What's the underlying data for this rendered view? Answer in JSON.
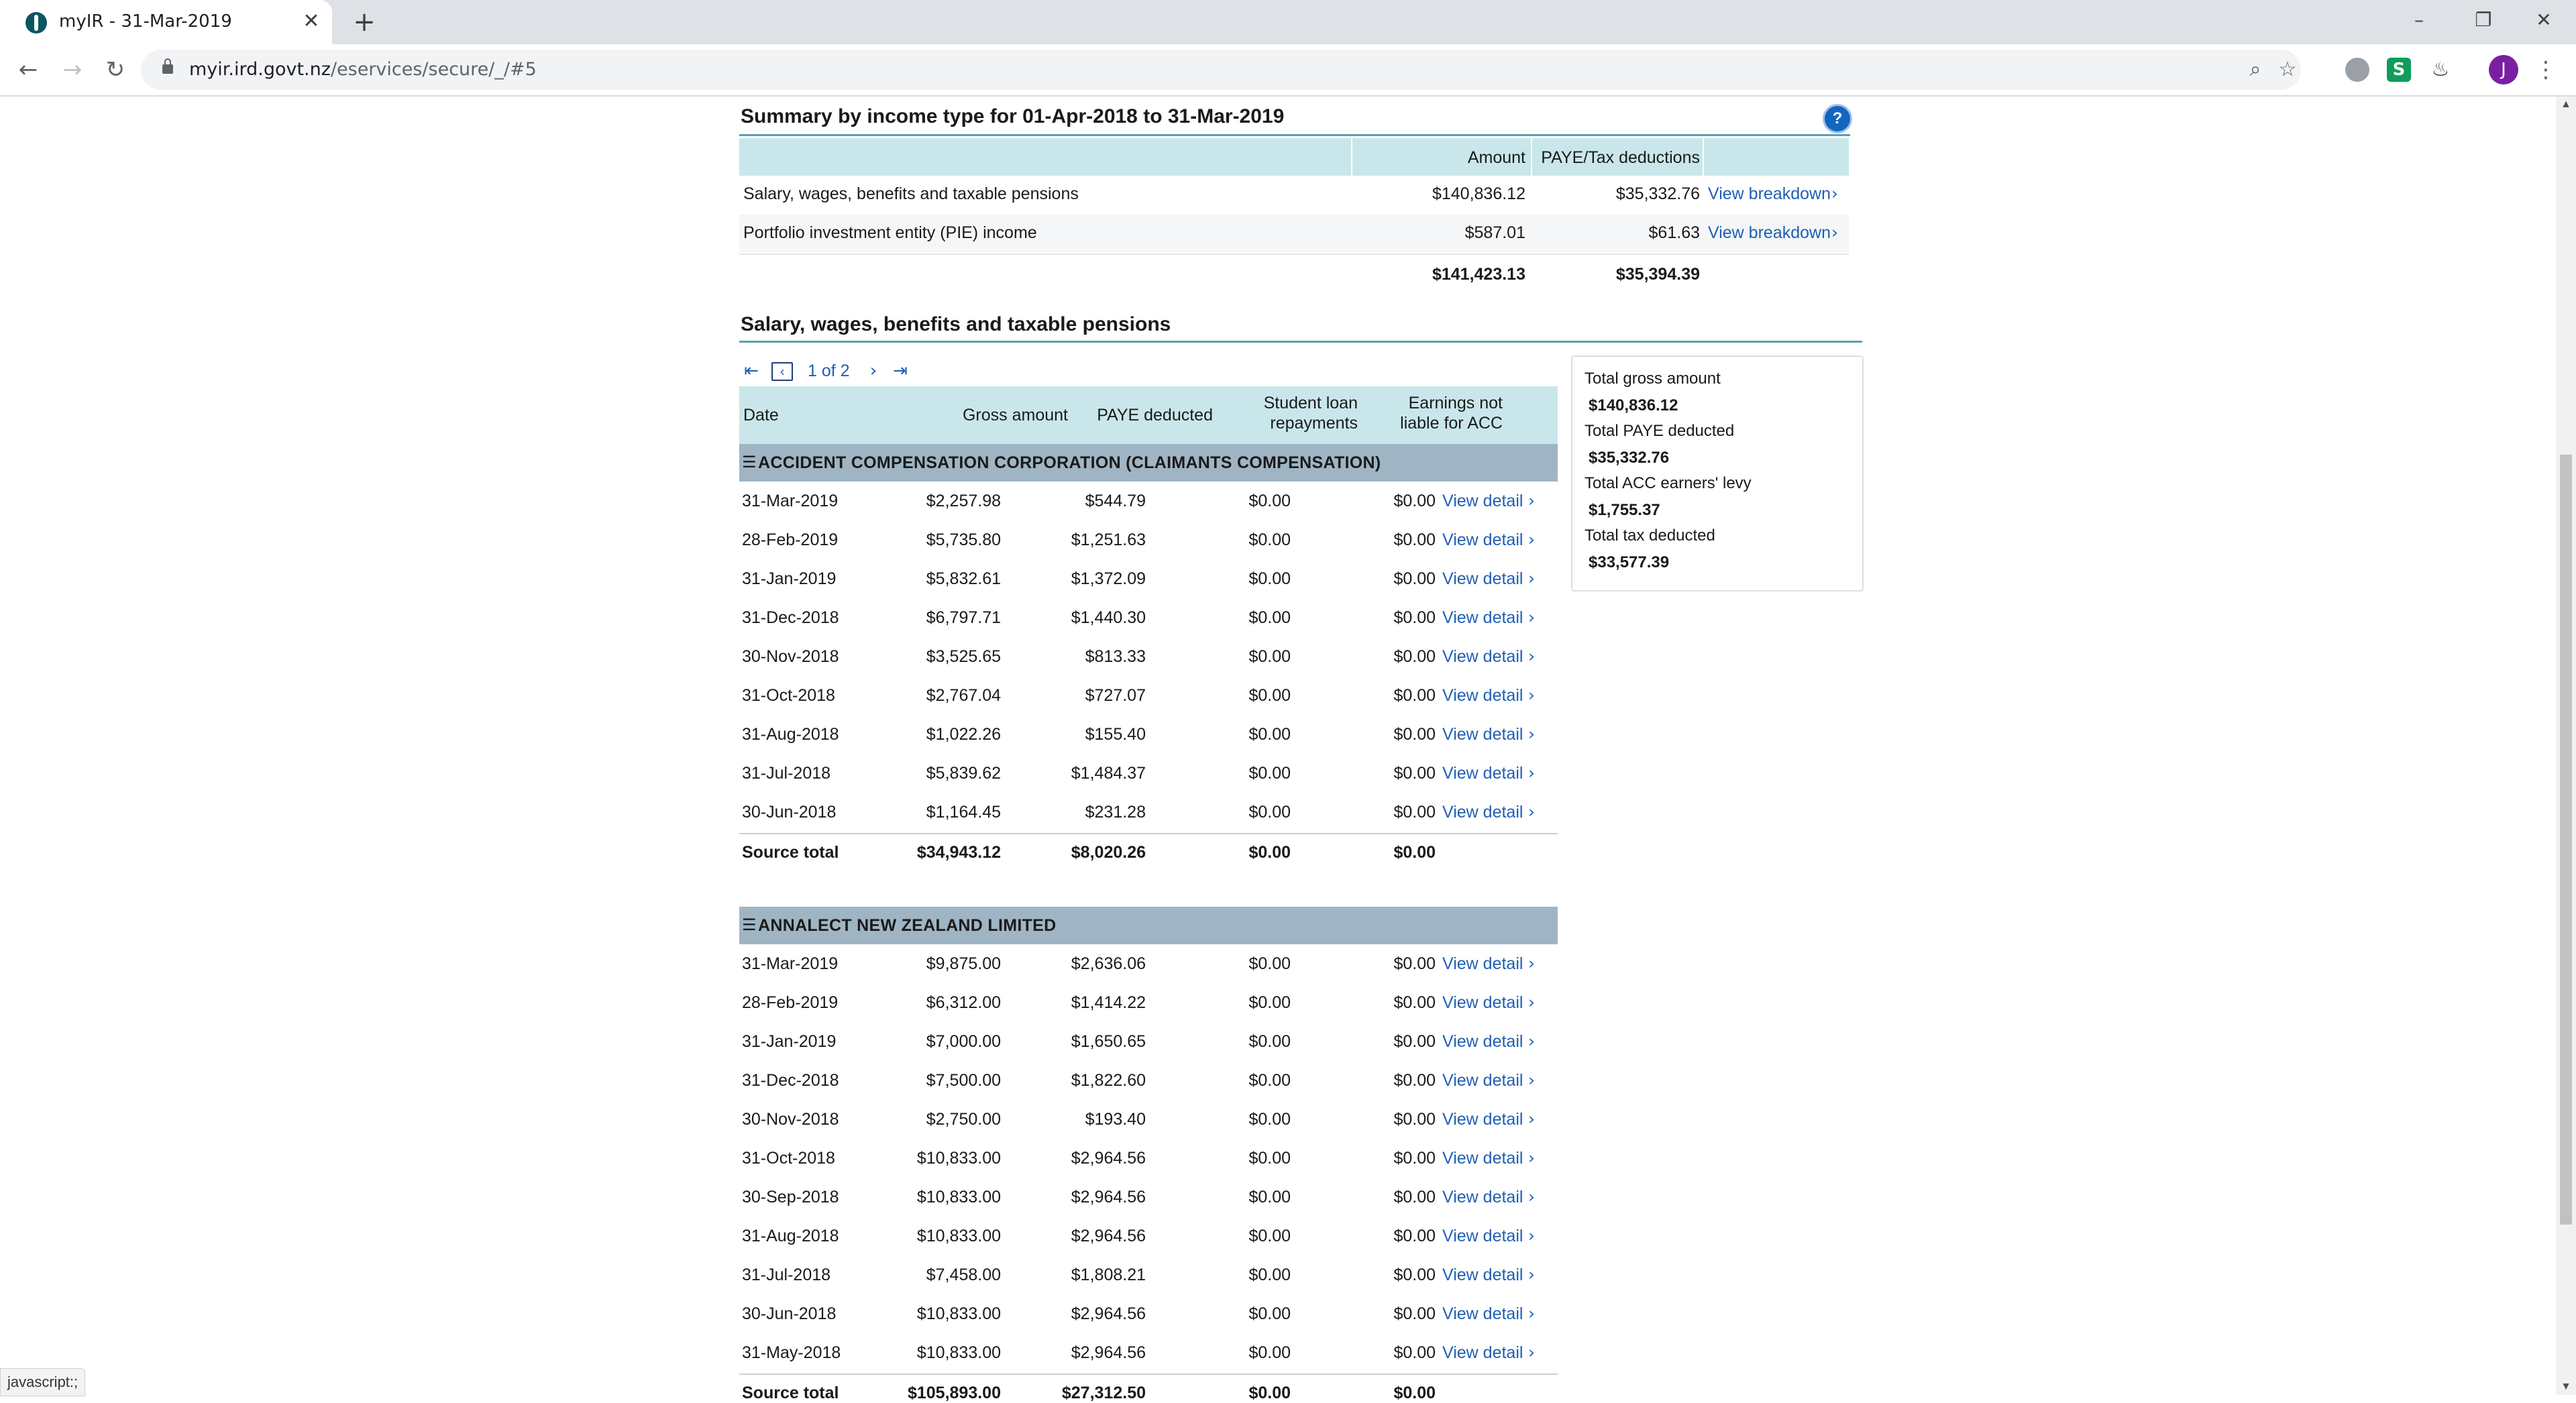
{
  "browser": {
    "tab_title": "myIR - 31-Mar-2019",
    "url_host": "myir.ird.govt.nz",
    "url_path": "/eservices/secure/_/#5",
    "profile_initial": "J",
    "status_text": "javascript:;"
  },
  "summary": {
    "title": "Summary by income type for 01-Apr-2018 to 31-Mar-2019",
    "columns": {
      "amount": "Amount",
      "paye": "PAYE/Tax deductions"
    },
    "rows": [
      {
        "type": "Salary, wages, benefits and taxable pensions",
        "amount": "$140,836.12",
        "paye": "$35,332.76",
        "link": "View breakdown"
      },
      {
        "type": "Portfolio investment entity (PIE) income",
        "amount": "$587.01",
        "paye": "$61.63",
        "link": "View breakdown"
      }
    ],
    "total": {
      "amount": "$141,423.13",
      "paye": "$35,394.39"
    }
  },
  "salary": {
    "title": "Salary, wages, benefits and taxable pensions",
    "pager": "1 of 2",
    "columns": {
      "date": "Date",
      "gross": "Gross amount",
      "paye": "PAYE deducted",
      "student_loan_1": "Student loan",
      "student_loan_2": "repayments",
      "earnings_1": "Earnings not",
      "earnings_2": "liable for ACC"
    },
    "groups": [
      {
        "name": "ACCIDENT COMPENSATION CORPORATION (CLAIMANTS COMPENSATION)",
        "rows": [
          {
            "date": "31-Mar-2019",
            "gross": "$2,257.98",
            "paye": "$544.79",
            "sl": "$0.00",
            "acc": "$0.00",
            "link": "View detail"
          },
          {
            "date": "28-Feb-2019",
            "gross": "$5,735.80",
            "paye": "$1,251.63",
            "sl": "$0.00",
            "acc": "$0.00",
            "link": "View detail"
          },
          {
            "date": "31-Jan-2019",
            "gross": "$5,832.61",
            "paye": "$1,372.09",
            "sl": "$0.00",
            "acc": "$0.00",
            "link": "View detail"
          },
          {
            "date": "31-Dec-2018",
            "gross": "$6,797.71",
            "paye": "$1,440.30",
            "sl": "$0.00",
            "acc": "$0.00",
            "link": "View detail"
          },
          {
            "date": "30-Nov-2018",
            "gross": "$3,525.65",
            "paye": "$813.33",
            "sl": "$0.00",
            "acc": "$0.00",
            "link": "View detail"
          },
          {
            "date": "31-Oct-2018",
            "gross": "$2,767.04",
            "paye": "$727.07",
            "sl": "$0.00",
            "acc": "$0.00",
            "link": "View detail"
          },
          {
            "date": "31-Aug-2018",
            "gross": "$1,022.26",
            "paye": "$155.40",
            "sl": "$0.00",
            "acc": "$0.00",
            "link": "View detail"
          },
          {
            "date": "31-Jul-2018",
            "gross": "$5,839.62",
            "paye": "$1,484.37",
            "sl": "$0.00",
            "acc": "$0.00",
            "link": "View detail"
          },
          {
            "date": "30-Jun-2018",
            "gross": "$1,164.45",
            "paye": "$231.28",
            "sl": "$0.00",
            "acc": "$0.00",
            "link": "View detail"
          }
        ],
        "total": {
          "label": "Source total",
          "gross": "$34,943.12",
          "paye": "$8,020.26",
          "sl": "$0.00",
          "acc": "$0.00"
        }
      },
      {
        "name": "ANNALECT NEW ZEALAND LIMITED",
        "rows": [
          {
            "date": "31-Mar-2019",
            "gross": "$9,875.00",
            "paye": "$2,636.06",
            "sl": "$0.00",
            "acc": "$0.00",
            "link": "View detail"
          },
          {
            "date": "28-Feb-2019",
            "gross": "$6,312.00",
            "paye": "$1,414.22",
            "sl": "$0.00",
            "acc": "$0.00",
            "link": "View detail"
          },
          {
            "date": "31-Jan-2019",
            "gross": "$7,000.00",
            "paye": "$1,650.65",
            "sl": "$0.00",
            "acc": "$0.00",
            "link": "View detail"
          },
          {
            "date": "31-Dec-2018",
            "gross": "$7,500.00",
            "paye": "$1,822.60",
            "sl": "$0.00",
            "acc": "$0.00",
            "link": "View detail"
          },
          {
            "date": "30-Nov-2018",
            "gross": "$2,750.00",
            "paye": "$193.40",
            "sl": "$0.00",
            "acc": "$0.00",
            "link": "View detail"
          },
          {
            "date": "31-Oct-2018",
            "gross": "$10,833.00",
            "paye": "$2,964.56",
            "sl": "$0.00",
            "acc": "$0.00",
            "link": "View detail"
          },
          {
            "date": "30-Sep-2018",
            "gross": "$10,833.00",
            "paye": "$2,964.56",
            "sl": "$0.00",
            "acc": "$0.00",
            "link": "View detail"
          },
          {
            "date": "31-Aug-2018",
            "gross": "$10,833.00",
            "paye": "$2,964.56",
            "sl": "$0.00",
            "acc": "$0.00",
            "link": "View detail"
          },
          {
            "date": "31-Jul-2018",
            "gross": "$7,458.00",
            "paye": "$1,808.21",
            "sl": "$0.00",
            "acc": "$0.00",
            "link": "View detail"
          },
          {
            "date": "30-Jun-2018",
            "gross": "$10,833.00",
            "paye": "$2,964.56",
            "sl": "$0.00",
            "acc": "$0.00",
            "link": "View detail"
          },
          {
            "date": "31-May-2018",
            "gross": "$10,833.00",
            "paye": "$2,964.56",
            "sl": "$0.00",
            "acc": "$0.00",
            "link": "View detail"
          }
        ],
        "total": {
          "label": "Source total",
          "gross": "$105,893.00",
          "paye": "$27,312.50",
          "sl": "$0.00",
          "acc": "$0.00"
        }
      }
    ]
  },
  "totals_box": {
    "gross_label": "Total gross amount",
    "gross_value": "$140,836.12",
    "paye_label": "Total PAYE deducted",
    "paye_value": "$35,332.76",
    "acc_label": "Total ACC earners' levy",
    "acc_value": "$1,755.37",
    "tax_label": "Total tax deducted",
    "tax_value": "$33,577.39"
  }
}
